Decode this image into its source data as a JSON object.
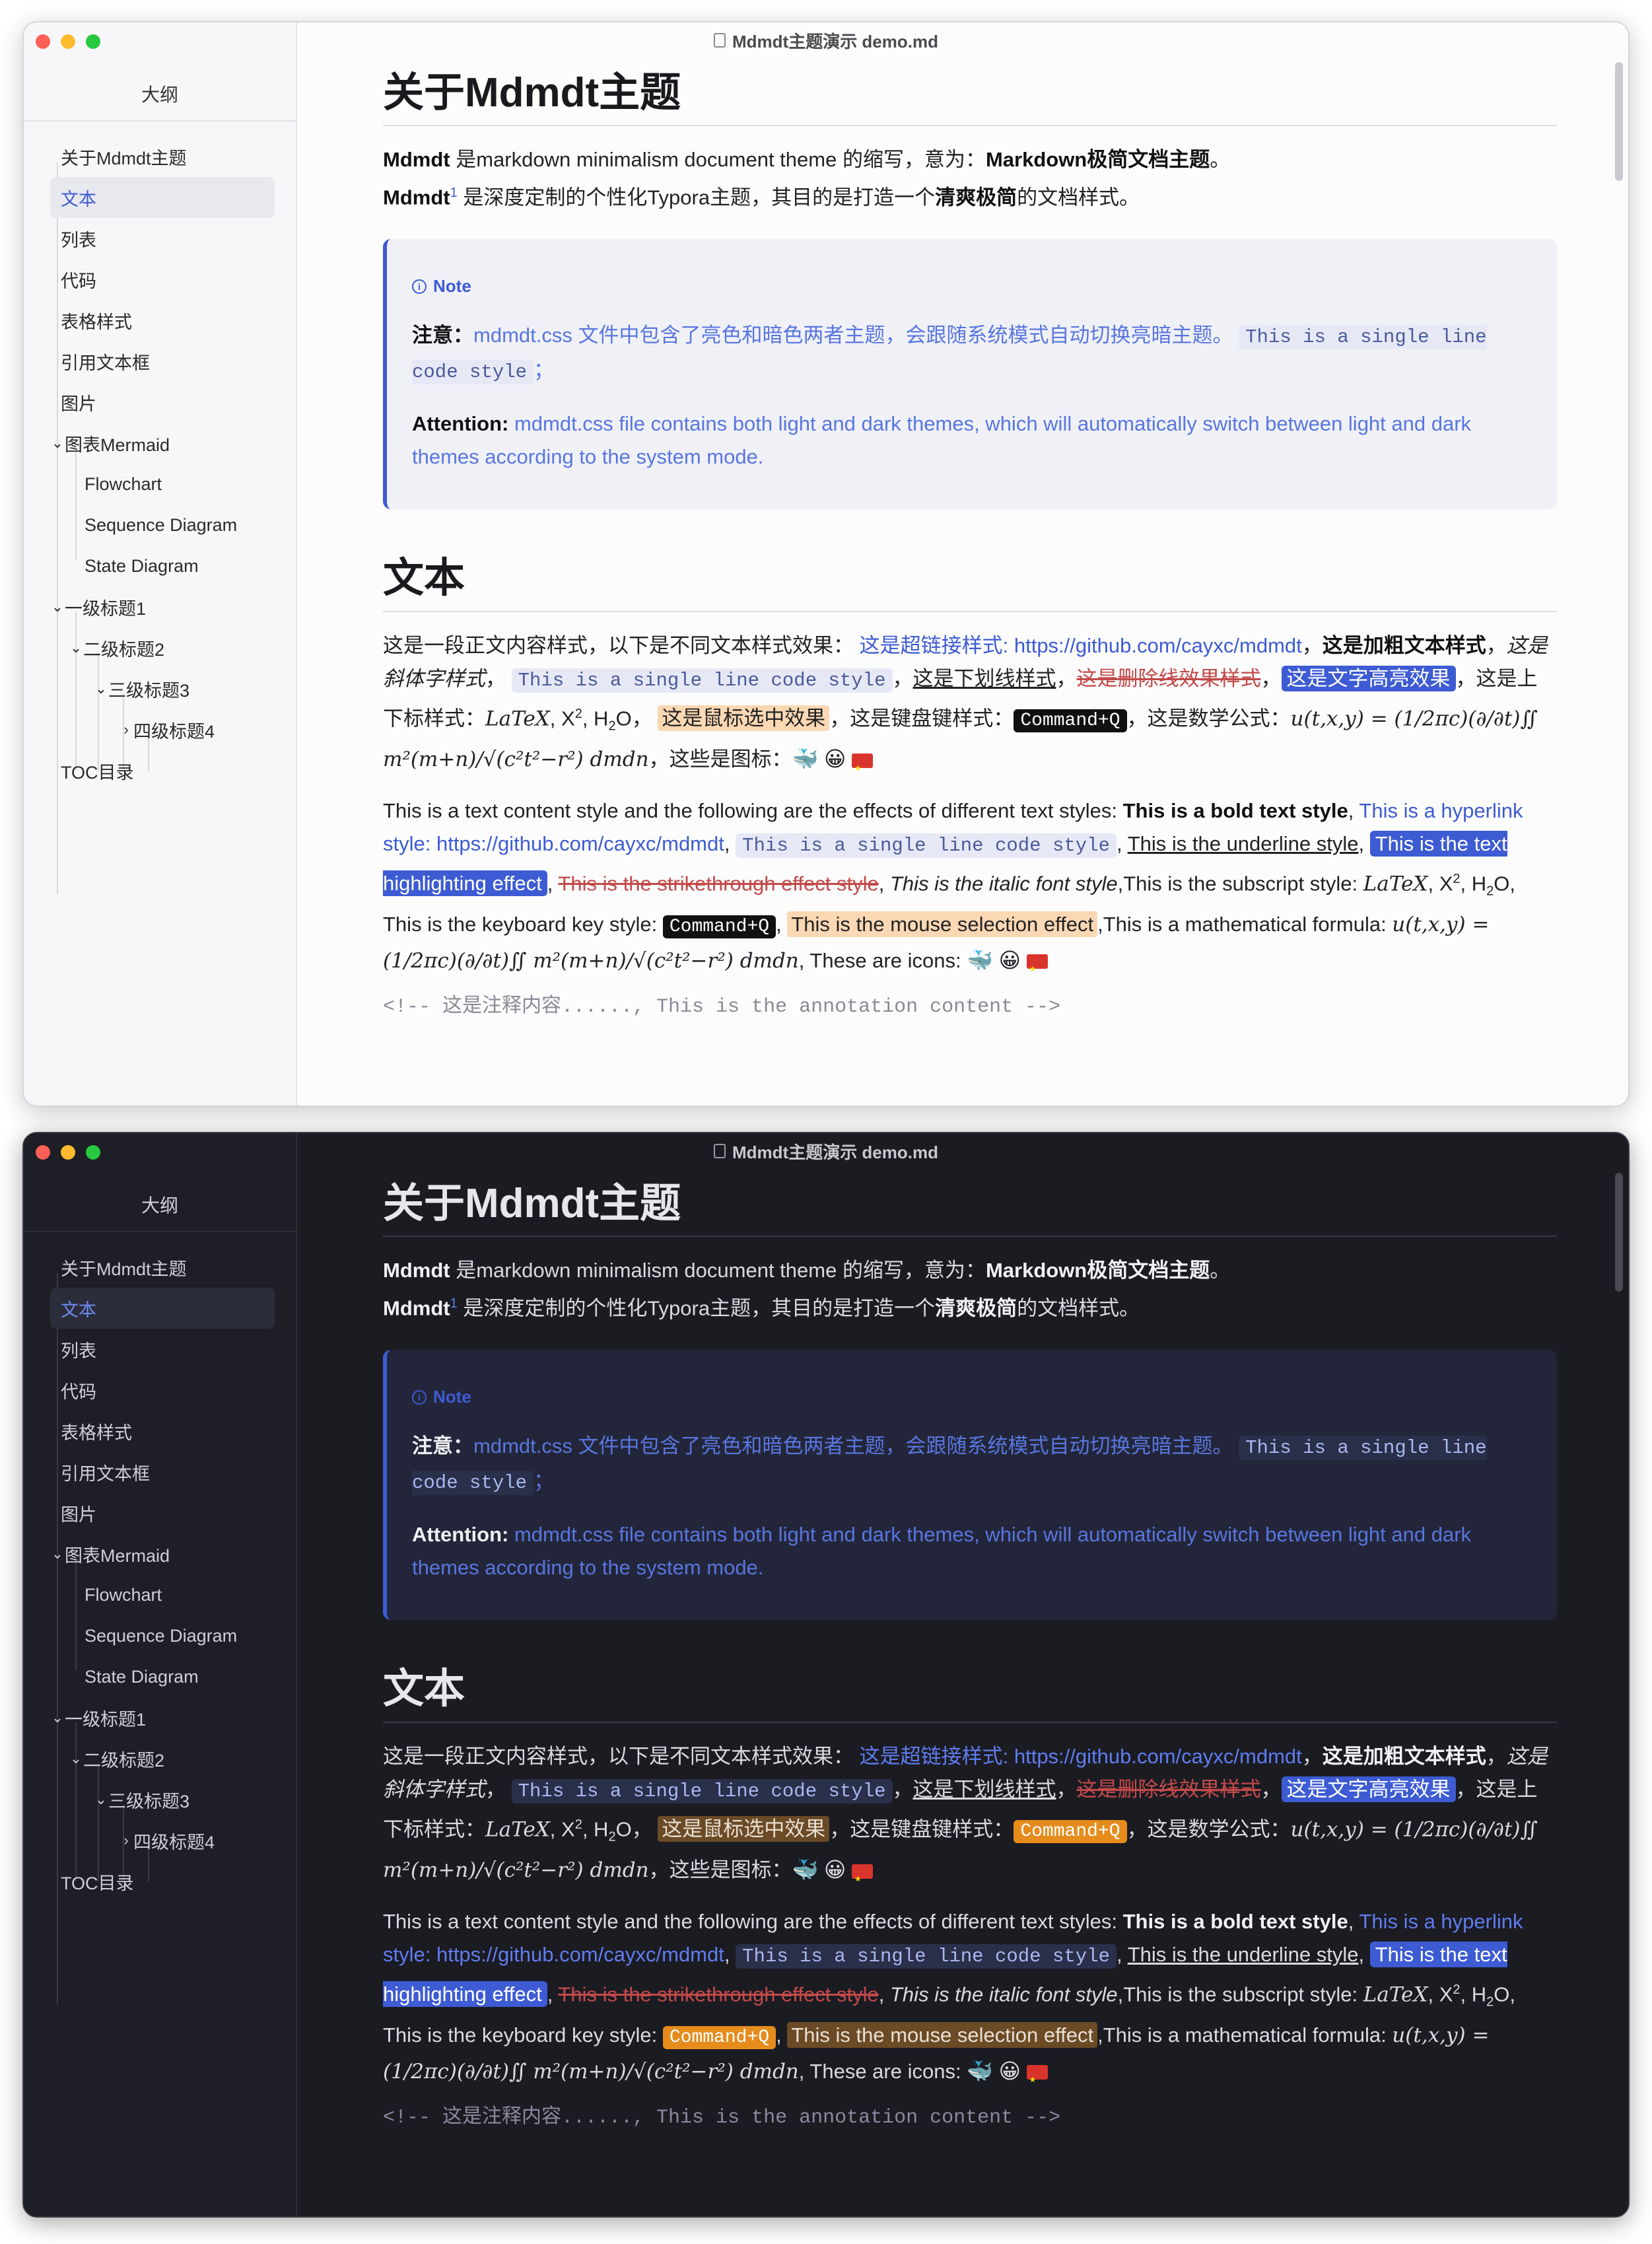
{
  "window": {
    "title": "Mdmdt主题演示 demo.md",
    "outline_heading": "大纲"
  },
  "toc": [
    {
      "label": "关于Mdmdt主题"
    },
    {
      "label": "文本"
    },
    {
      "label": "列表"
    },
    {
      "label": "代码"
    },
    {
      "label": "表格样式"
    },
    {
      "label": "引用文本框"
    },
    {
      "label": "图片"
    },
    {
      "label": "图表Mermaid"
    },
    {
      "label": "Flowchart"
    },
    {
      "label": "Sequence Diagram"
    },
    {
      "label": "State Diagram"
    },
    {
      "label": "一级标题1"
    },
    {
      "label": "二级标题2"
    },
    {
      "label": "三级标题3"
    },
    {
      "label": "四级标题4"
    },
    {
      "label": "TOC目录"
    }
  ],
  "doc": {
    "h1_about": "关于Mdmdt主题",
    "intro1_a": "Mdmdt",
    "intro1_b": " 是markdown minimalism document theme 的缩写，意为：",
    "intro1_c": "Markdown极简文档主题",
    "intro1_d": "。",
    "intro2_a": "Mdmdt",
    "intro2_sup": "1",
    "intro2_b": " 是深度定制的个性化Typora主题，其目的是打造一个",
    "intro2_c": "清爽极简",
    "intro2_d": "的文档样式。",
    "note_title": "Note",
    "note_zh_label": "注意：",
    "note_zh_text": "mdmdt.css 文件中包含了亮色和暗色两者主题，会跟随系统模式自动切换亮暗主题。",
    "note_code": "This is a single line code style",
    "note_zh_end": "；",
    "note_en_label": "Attention:",
    "note_en_text": " mdmdt.css file contains both light and dark themes, which will automatically switch between light and dark themes according to the system mode.",
    "h1_text": "文本",
    "zh": {
      "p1": "这是一段正文内容样式，以下是不同文本样式效果：",
      "link": "这是超链接样式: https://github.com/cayxc/mdmdt",
      "c1": "，",
      "bold": "这是加粗文本样式",
      "c2": "，",
      "italic": "这是斜体字样式",
      "c3": "，",
      "code": "This is a single line code style",
      "c4": "，",
      "underline": "这是下划线样式",
      "c5": "，",
      "strike": "这是删除线效果样式",
      "c6": "，",
      "highlight": "这是文字高亮效果",
      "sub_label": "，这是上下标样式：",
      "latex": "LaTeX",
      "x2": "X",
      "h2o": "H",
      "h2o_o": "O",
      "c7": "，",
      "selection": "这是鼠标选中效果",
      "kbd_label": "，这是键盘键样式：",
      "kbd": "Command+Q",
      "math_label": "，这是数学公式：",
      "formula": "u(t,x,y) = (1/2πc)(∂/∂t)∬ m²(m+n)/√(c²t²−r²) dmdn",
      "icons_label": "，这些是图标："
    },
    "en": {
      "p1": "This is a text content style and the following are the effects of different text styles: ",
      "bold": "This is a bold text style",
      "c1": ",",
      "link": "This is a hyperlink style: https://github.com/cayxc/mdmdt",
      "c2": ",",
      "code": "This is a single line code style",
      "c3": ",",
      "underline": "This is the underline style",
      "c4": ",",
      "highlight": "This is the text highlighting effect",
      "c5": ",",
      "strike": "This is the strikethrough effect style",
      "c6": ",",
      "italic": "This is the italic font style",
      "sub_label": ",This is the subscript style: ",
      "latex": "LaTeX",
      "x2": "X",
      "h2o": "H",
      "h2o_o": "O",
      "kbd_label": ", This is the keyboard key style: ",
      "kbd": "Command+Q",
      "c7": ",",
      "selection": "This is the mouse selection effect",
      "math_label": ",This is a mathematical formula: ",
      "formula": "u(t,x,y) = (1/2πc)(∂/∂t)∬ m²(m+n)/√(c²t²−r²) dmdn",
      "icons_label": ",  These are icons: "
    },
    "comment": "<!-- 这是注释内容......, This is the annotation content -->",
    "sup2": "2",
    "sub2": "2",
    "emoji_whale": "🐳",
    "emoji_smile": "😀"
  },
  "colors": {
    "accent": "#3d5bd3",
    "selection_light": "#fbd8b4",
    "selection_dark": "#6b4a26",
    "kbd_dark": "#e58c1d",
    "strike": "#c24a4a"
  },
  "icons": [
    "file-icon",
    "info-icon",
    "chevron-down-icon",
    "chevron-right-icon",
    "whale-emoji-icon",
    "smile-emoji-icon",
    "china-flag-icon"
  ]
}
